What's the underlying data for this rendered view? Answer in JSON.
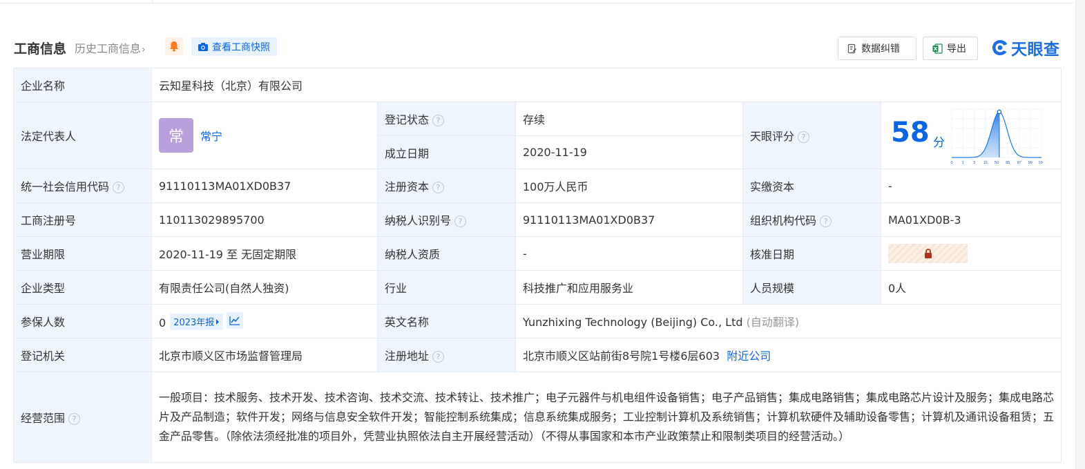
{
  "header": {
    "title": "工商信息",
    "history": "历史工商信息",
    "snapshot": "查看工商快照",
    "correct": "数据纠错",
    "export": "导出",
    "brand": "天眼查"
  },
  "colors": {
    "accent": "#0a66e0",
    "label_bg": "#eef5fd",
    "status_green": "#1aaa55",
    "avatar": "#b9a0dd"
  },
  "company": {
    "name_label": "企业名称",
    "name": "云知星科技（北京）有限公司",
    "legal_rep_label": "法定代表人",
    "legal_rep_avatar": "常",
    "legal_rep": "常宁",
    "reg_status_label": "登记状态",
    "reg_status": "存续",
    "founded_label": "成立日期",
    "founded": "2020-11-19",
    "score_label": "天眼评分",
    "score": "58",
    "score_unit": "分",
    "score_ticks": [
      "0",
      "1",
      "3",
      "15",
      "50",
      "85",
      "97",
      "99",
      "100"
    ],
    "credit_code_label": "统一社会信用代码",
    "credit_code": "91110113MA01XD0B37",
    "reg_capital_label": "注册资本",
    "reg_capital": "100万人民币",
    "paid_capital_label": "实缴资本",
    "paid_capital": "-",
    "biz_reg_no_label": "工商注册号",
    "biz_reg_no": "110113029895700",
    "taxpayer_id_label": "纳税人识别号",
    "taxpayer_id": "91110113MA01XD0B37",
    "org_code_label": "组织机构代码",
    "org_code": "MA01XD0B-3",
    "term_label": "营业期限",
    "term": "2020-11-19 至 无固定期限",
    "taxpayer_qual_label": "纳税人资质",
    "taxpayer_qual": "-",
    "approval_label": "核准日期",
    "type_label": "企业类型",
    "type": "有限责任公司(自然人独资)",
    "industry_label": "行业",
    "industry": "科技推广和应用服务业",
    "staff_label": "人员规模",
    "staff": "0人",
    "insured_label": "参保人数",
    "insured": "0",
    "insured_year": "2023年报",
    "en_name_label": "英文名称",
    "en_name": "Yunzhixing Technology (Beijing) Co., Ltd",
    "en_name_note": "(自动翻译)",
    "authority_label": "登记机关",
    "authority": "北京市顺义区市场监督管理局",
    "address_label": "注册地址",
    "address": "北京市顺义区站前街8号院1号楼6层603",
    "nearby": "附近公司",
    "scope_label": "经营范围",
    "scope": "一般项目：技术服务、技术开发、技术咨询、技术交流、技术转让、技术推广；电子元器件与机电组件设备销售；电子产品销售；集成电路销售；集成电路芯片设计及服务；集成电路芯片及产品制造；软件开发；网络与信息安全软件开发；智能控制系统集成；信息系统集成服务；工业控制计算机及系统销售；计算机软硬件及辅助设备零售；计算机及通讯设备租赁；五金产品零售。（除依法须经批准的项目外，凭营业执照依法自主开展经营活动）（不得从事国家和本市产业政策禁止和限制类项目的经营活动。）"
  }
}
